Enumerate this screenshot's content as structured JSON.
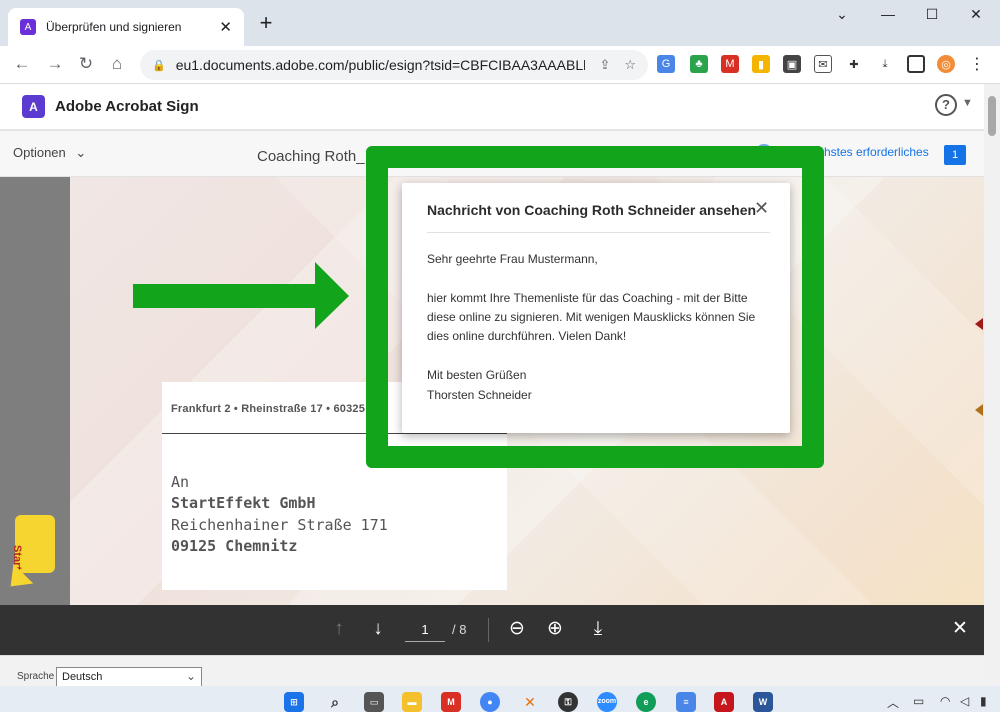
{
  "browser": {
    "tab_title": "Überprüfen und signieren",
    "url": "eu1.documents.adobe.com/public/esign?tsid=CBFCIBAA3AAABLb..."
  },
  "app": {
    "name": "Adobe Acrobat Sign",
    "help": "?"
  },
  "subheader": {
    "options_label": "Optionen",
    "doc_title": "Coaching Roth_",
    "next_required_label": "chstes erforderliches",
    "next_required_count": "1"
  },
  "document": {
    "sender_line": "Frankfurt 2 • Rheinstraße 17 • 60325 Frankfu",
    "address": {
      "prefix": "An",
      "company": "StartEffekt GmbH",
      "street": "Reichenhainer Straße 171",
      "city": "09125 Chemnitz"
    },
    "start_flag": "Start"
  },
  "popup": {
    "title": "Nachricht von Coaching Roth Schneider ansehen",
    "greeting": "Sehr geehrte Frau Mustermann,",
    "body_line1": "hier kommt Ihre Themenliste für das Coaching - mit der Bitte",
    "body_line2": "diese online zu signieren. Mit wenigen Mausklicks können Sie",
    "body_line3": "dies online durchführen. Vielen Dank!",
    "closing": "Mit besten Grüßen",
    "signature": "Thorsten Schneider"
  },
  "pager": {
    "current_page": "1",
    "total_pages": "/ 8"
  },
  "footer": {
    "language_label": "Sprache",
    "language_value": "Deutsch"
  },
  "colors": {
    "highlight_green": "#12a41b",
    "adobe_accent": "#1473e6"
  }
}
